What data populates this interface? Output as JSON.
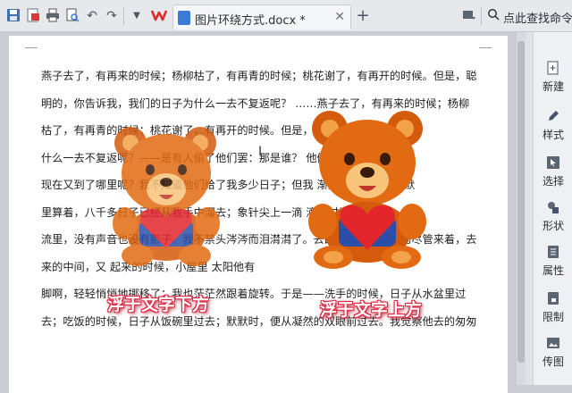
{
  "toolbar": {
    "tab_title": "图片环绕方式.docx *",
    "close_symbol": "✕",
    "new_tab_symbol": "+",
    "command_search": "点此查找命令"
  },
  "document": {
    "lines": [
      "燕子去了，有再来的时候；杨柳枯了，有再青的时候；桃花谢了，有再开的时候。但是，聪",
      "明的，你告诉我，我们的日子为什么一去不复返呢？   ……燕子去了，有再来的时候；杨柳",
      "枯了，有再青的时候；桃花谢了，有再开的时候。但是，              ，我们的日子为",
      "什么一去不复返呢？——是有人偷了他们罢：那是谁？                  他们自己逃走了：",
      "现在又到了哪里呢？我不知道他们给了我多少日子；但我           渐渐空虚了。在默默",
      "里算着，八千多日子已经从我手中溜去；象针尖上一滴              滴在时间的",
      "流里，没有声音也没有影子。我不禁头涔涔而泪潸潸了。去的尽管去了，来的尽管来着，去",
      "来的中间，又                            起来的时候，小屋里              太阳他有",
      "脚啊，轻轻悄悄地挪移了；我也茫茫然跟着旋转。于是——洗手的时候，日子从水盆里过",
      "去；吃饭的时候，日子从饭碗里过去；默默时，便从凝然的双眼前过去。我觉察他去的匆匆"
    ]
  },
  "images": {
    "left_caption": "浮于文字下方",
    "right_caption": "浮于文字上方"
  },
  "sidebar": {
    "items": [
      {
        "label": "新建",
        "icon": "plus-icon"
      },
      {
        "label": "样式",
        "icon": "pen-icon"
      },
      {
        "label": "选择",
        "icon": "cursor-icon"
      },
      {
        "label": "形状",
        "icon": "shapes-icon"
      },
      {
        "label": "属性",
        "icon": "properties-icon"
      },
      {
        "label": "限制",
        "icon": "lock-icon"
      },
      {
        "label": "传图",
        "icon": "image-icon"
      }
    ]
  },
  "colors": {
    "accent": "#3b7bd5",
    "caption_outline": "#d8203a",
    "wps_red": "#e02b2b"
  }
}
